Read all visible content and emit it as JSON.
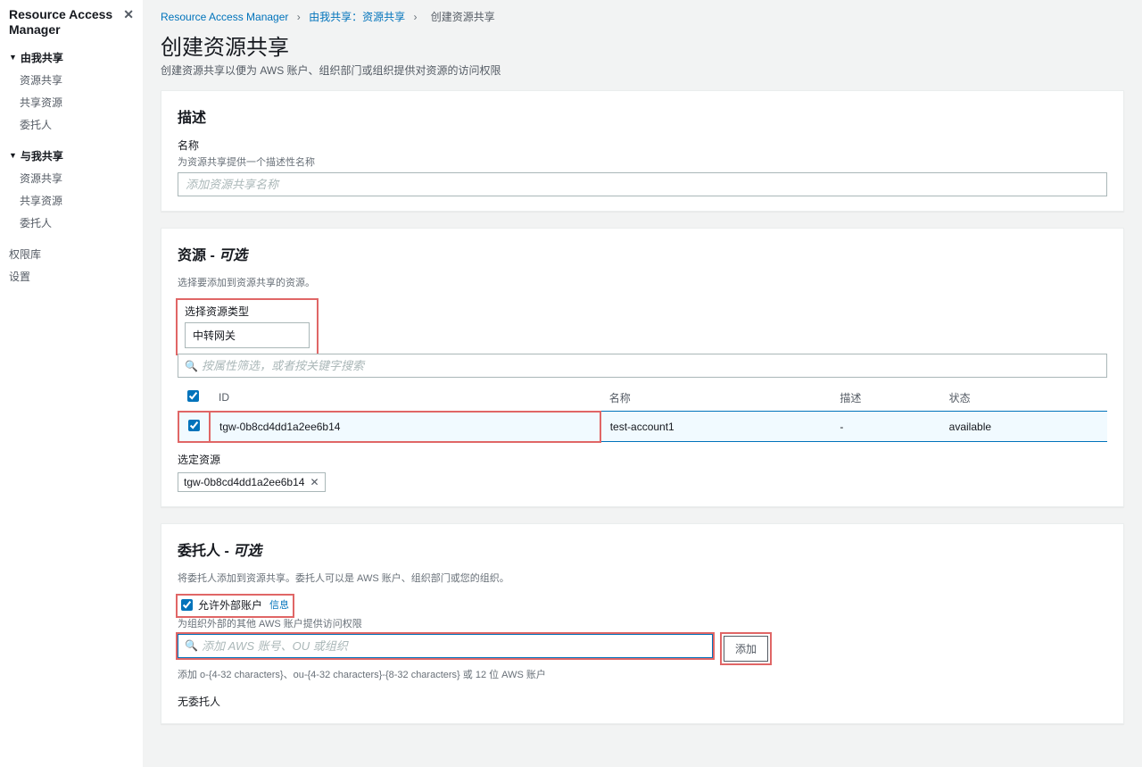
{
  "sidebar": {
    "title": "Resource Access Manager",
    "groups": [
      {
        "label": "由我共享",
        "items": [
          "资源共享",
          "共享资源",
          "委托人"
        ]
      },
      {
        "label": "与我共享",
        "items": [
          "资源共享",
          "共享资源",
          "委托人"
        ]
      }
    ],
    "extra": [
      "权限库",
      "设置"
    ]
  },
  "breadcrumb": {
    "root": "Resource Access Manager",
    "mid": "由我共享：资源共享",
    "current": "创建资源共享"
  },
  "page": {
    "title": "创建资源共享",
    "desc": "创建资源共享以便为 AWS 账户、组织部门或组织提供对资源的访问权限"
  },
  "descriptionPanel": {
    "title": "描述",
    "nameLabel": "名称",
    "nameHint": "为资源共享提供一个描述性名称",
    "namePlaceholder": "添加资源共享名称"
  },
  "resourcesPanel": {
    "title": "资源 - ",
    "titleEm": "可选",
    "hint": "选择要添加到资源共享的资源。",
    "selectTypeLabel": "选择资源类型",
    "selectTypeValue": "中转网关",
    "filterPlaceholder": "按属性筛选，或者按关键字搜索",
    "columns": {
      "id": "ID",
      "name": "名称",
      "desc": "描述",
      "status": "状态"
    },
    "rows": [
      {
        "id": "tgw-0b8cd4dd1a2ee6b14",
        "name": "test-account1",
        "desc": "-",
        "status": "available",
        "checked": true
      }
    ],
    "selectedLabel": "选定资源",
    "selectedChip": "tgw-0b8cd4dd1a2ee6b14"
  },
  "principalsPanel": {
    "title": "委托人 - ",
    "titleEm": "可选",
    "hint": "将委托人添加到资源共享。委托人可以是 AWS 账户、组织部门或您的组织。",
    "allowExternalLabel": "允许外部账户",
    "allowExternalInfo": "信息",
    "allowExternalHint": "为组织外部的其他 AWS 账户提供访问权限",
    "searchPlaceholder": "添加 AWS 账号、OU 或组织",
    "addButton": "添加",
    "formatHint": "添加 o-{4-32 characters}、ou-{4-32 characters}-{8-32 characters} 或 12 位 AWS 账户",
    "noPrincipal": "无委托人"
  }
}
